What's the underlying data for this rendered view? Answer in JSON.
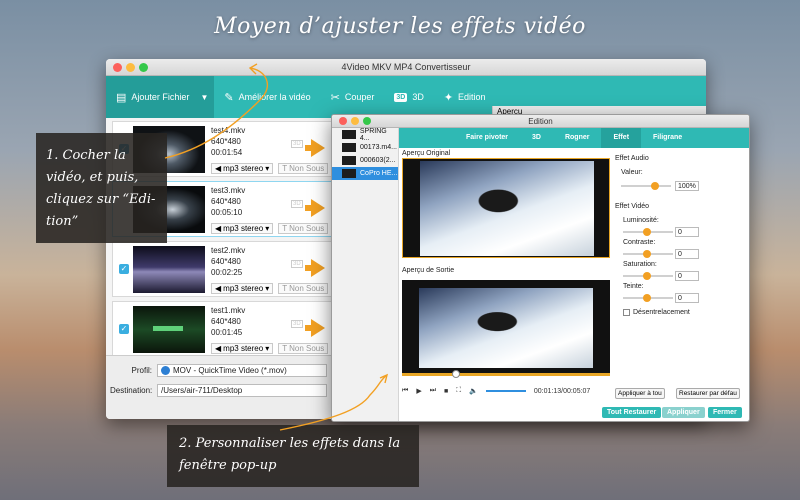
{
  "headline": "Moyen d’ajuster les effets vidéo",
  "main_window": {
    "title": "4Video MKV MP4 Convertisseur",
    "toolbar": {
      "add_file": "Ajouter Fichier",
      "enhance": "Améliorer la vidéo",
      "cut": "Couper",
      "three_d": "3D",
      "edit": "Edition",
      "three_d_badge": "3D"
    },
    "preview_label": "Aperçu",
    "files": [
      {
        "name": "test4.mkv",
        "res": "640*480",
        "dur": "00:01:54",
        "audio": "mp3 stereo",
        "sub": "Non Sous"
      },
      {
        "name": "test3.mkv",
        "res": "640*480",
        "dur": "00:05:10",
        "audio": "mp3 stereo",
        "sub": "Non Sous"
      },
      {
        "name": "test2.mkv",
        "res": "640*480",
        "dur": "00:02:25",
        "audio": "mp3 stereo",
        "sub": "Non Sous"
      },
      {
        "name": "test1.mkv",
        "res": "640*480",
        "dur": "00:01:45",
        "audio": "mp3 stereo",
        "sub": "Non Sous"
      }
    ],
    "profile_label": "Profil:",
    "profile_value": "MOV - QuickTime Video (*.mov)",
    "destination_label": "Destination:",
    "destination_value": "/Users/air-711/Desktop"
  },
  "edition_window": {
    "title": "Edition",
    "files": [
      "SPRING 4...",
      "00173.m4...",
      "000603(2...",
      "CoPro HE..."
    ],
    "active_file_index": 3,
    "tabs": [
      "Faire pivoter",
      "3D",
      "Rogner",
      "Effet",
      "Filigrane"
    ],
    "active_tab": "Effet",
    "original_label": "Aperçu Original",
    "output_label": "Aperçu de Sortie",
    "time": "00:01:13/00:05:07",
    "audio_section": "Effet Audio",
    "volume_label": "Valeur:",
    "volume_value": "100%",
    "video_section": "Effet Vidéo",
    "brightness_label": "Luminosité:",
    "brightness_value": "0",
    "contrast_label": "Contraste:",
    "contrast_value": "0",
    "saturation_label": "Saturation:",
    "saturation_value": "0",
    "hue_label": "Teinte:",
    "hue_value": "0",
    "deinterlace_label": "Désentrelacement",
    "apply_all": "Appliquer à tou",
    "restore_default": "Restaurer par défau",
    "restore_all": "Tout Restaurer",
    "apply": "Appliquer",
    "close": "Fermer"
  },
  "callouts": {
    "step1": "1. Cocher la vidéo, et puis, cliquez sur “Edi-tion”",
    "step2": "2. Personnaliser les effets dans la fenêtre pop-up"
  },
  "colors": {
    "accent": "#2fb9b4",
    "arrow": "#f2a023",
    "selection": "#2f8fdf"
  }
}
